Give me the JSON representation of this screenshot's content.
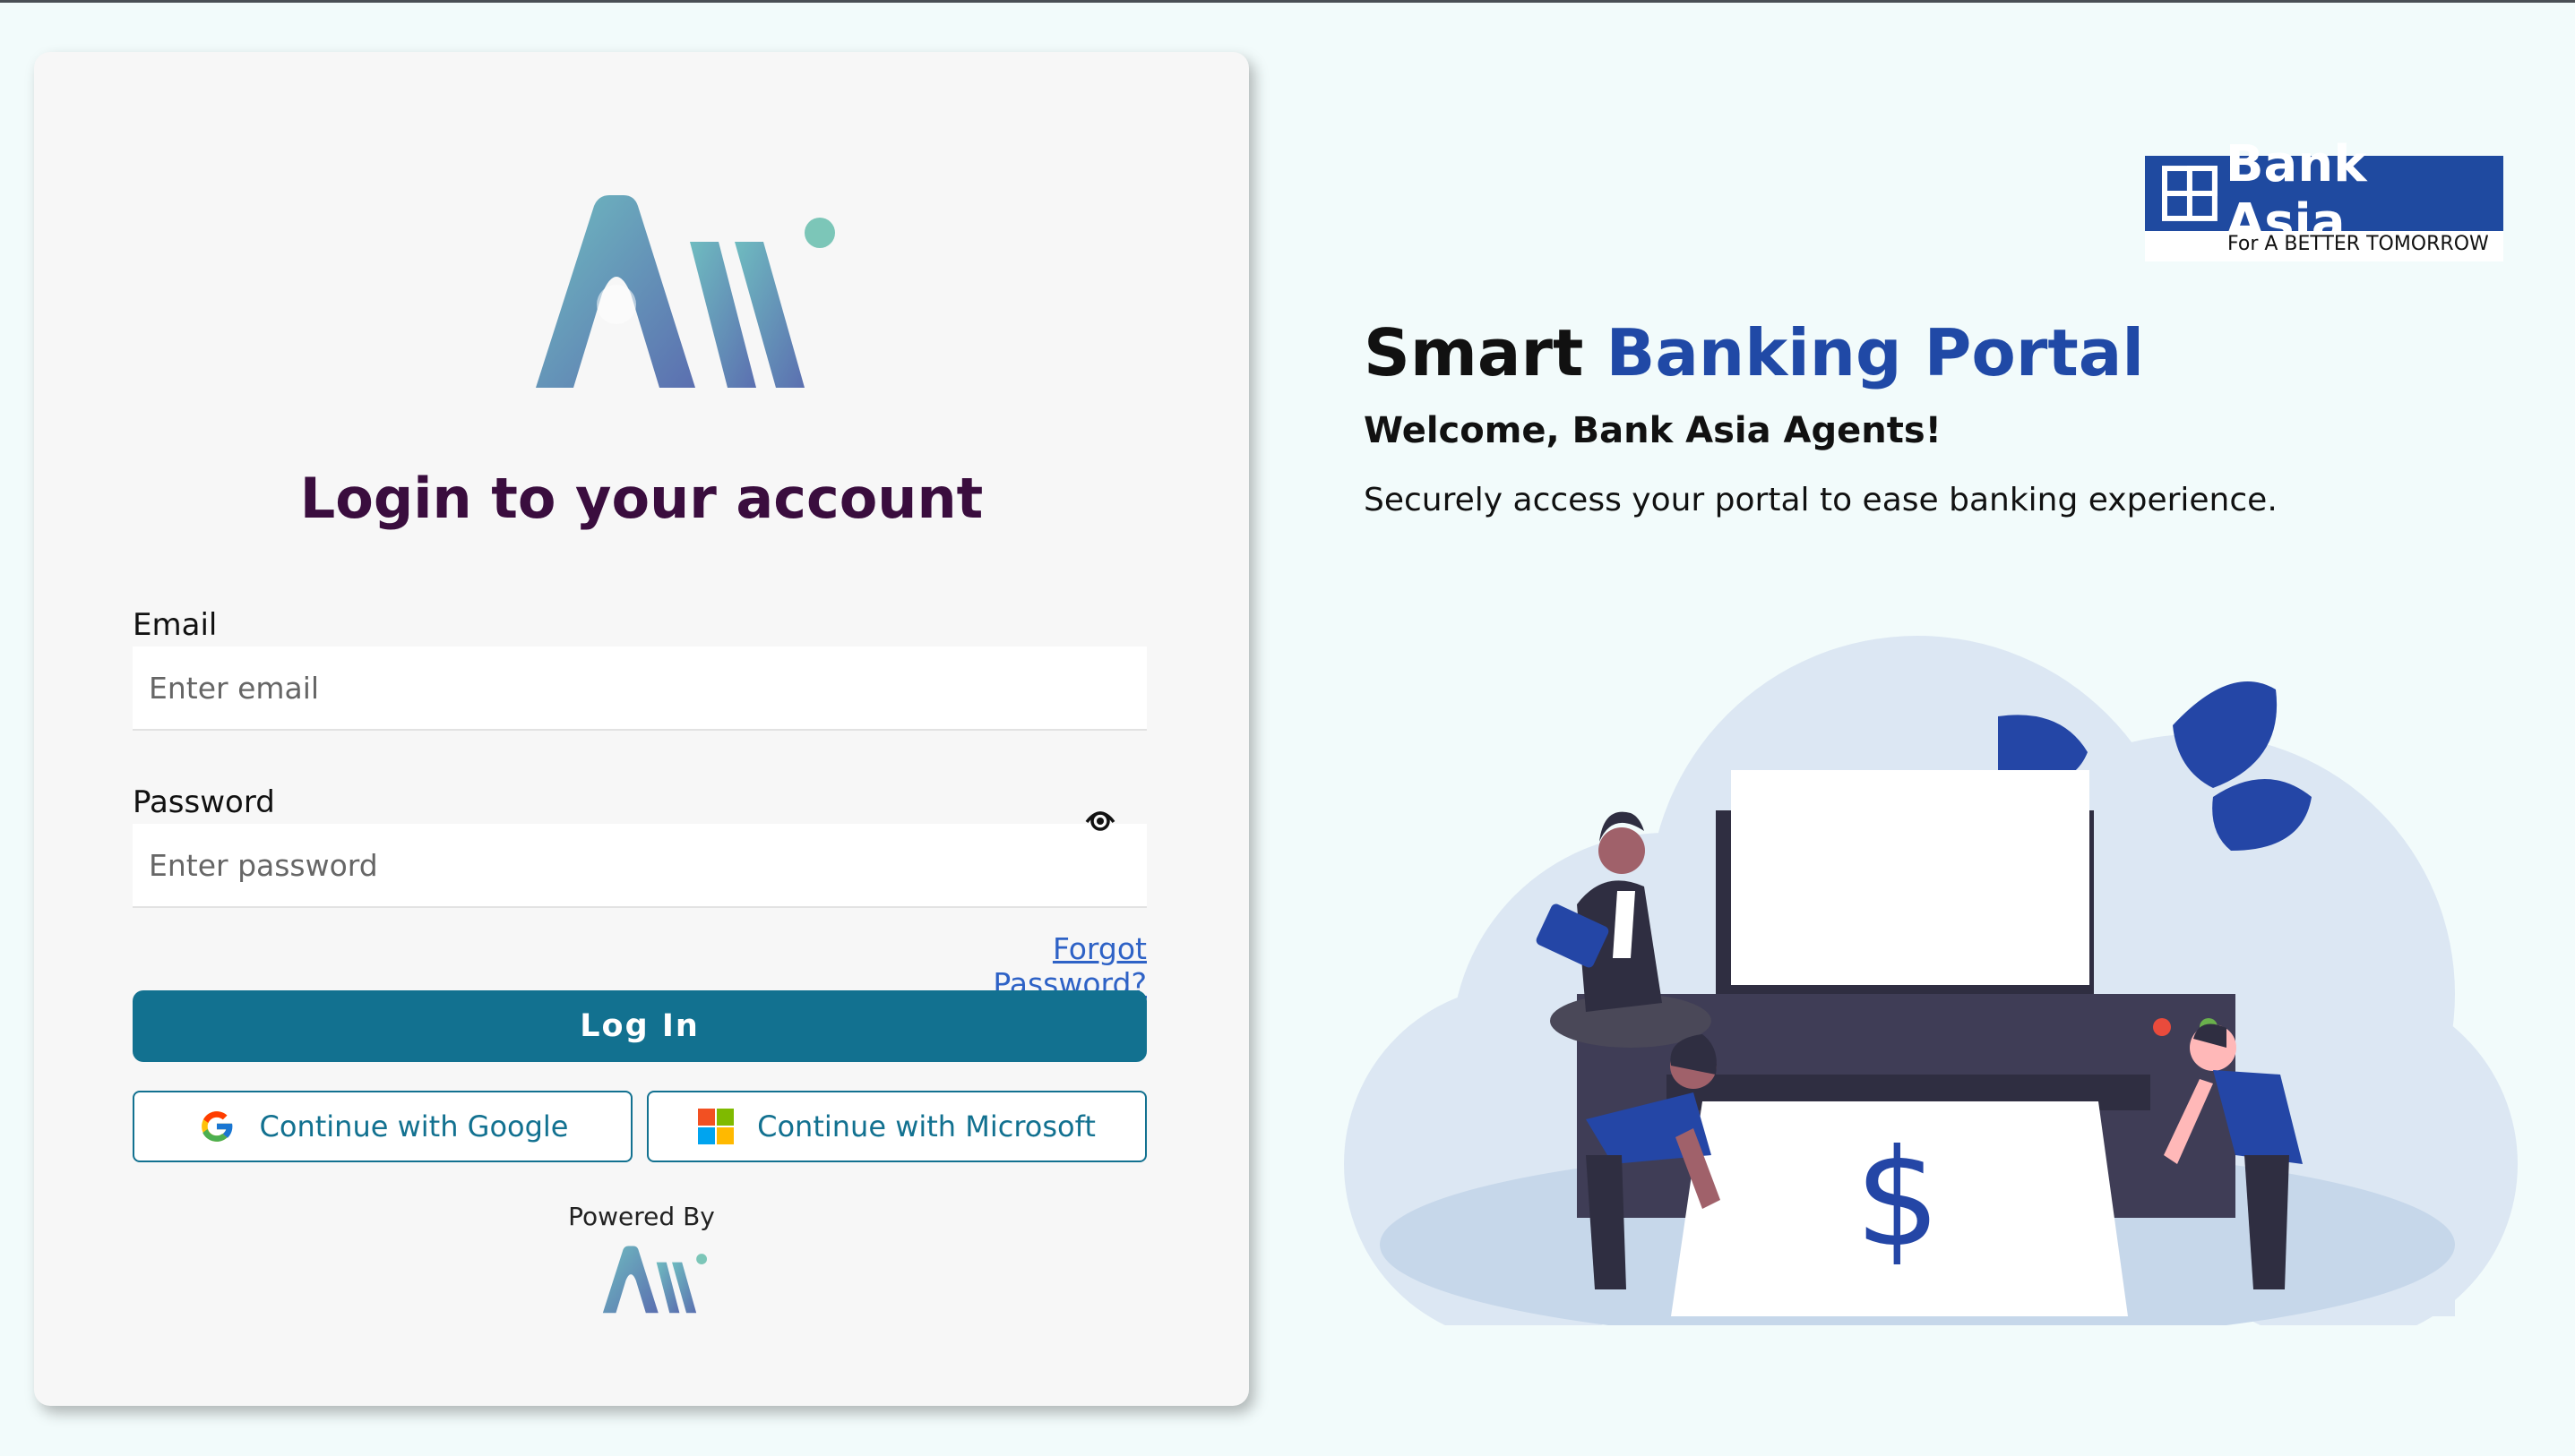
{
  "login": {
    "title": "Login to your account",
    "email_label": "Email",
    "email_placeholder": "Enter email",
    "email_value": "",
    "password_label": "Password",
    "password_placeholder": "Enter password",
    "password_value": "",
    "forgot_link": "Forgot Password?",
    "login_button": "Log In",
    "google_button": "Continue with Google",
    "microsoft_button": "Continue with Microsoft",
    "powered_by": "Powered By"
  },
  "brand": {
    "name": "Bank Asia",
    "tagline": "For A BETTER TOMORROW",
    "color": "#1f4aa0"
  },
  "hero": {
    "title_part1": "Smart",
    "title_part2": "Banking Portal",
    "welcome": "Welcome, Bank Asia Agents!",
    "subtitle": "Securely access your portal to ease banking experience.",
    "receipt_symbol": "$"
  },
  "colors": {
    "primary": "#127190",
    "title": "#3a0d3e",
    "link": "#2e62c6",
    "accent": "#2049a6"
  },
  "icons": {
    "eye": "eye-icon",
    "google": "google-icon",
    "microsoft": "microsoft-icon"
  }
}
